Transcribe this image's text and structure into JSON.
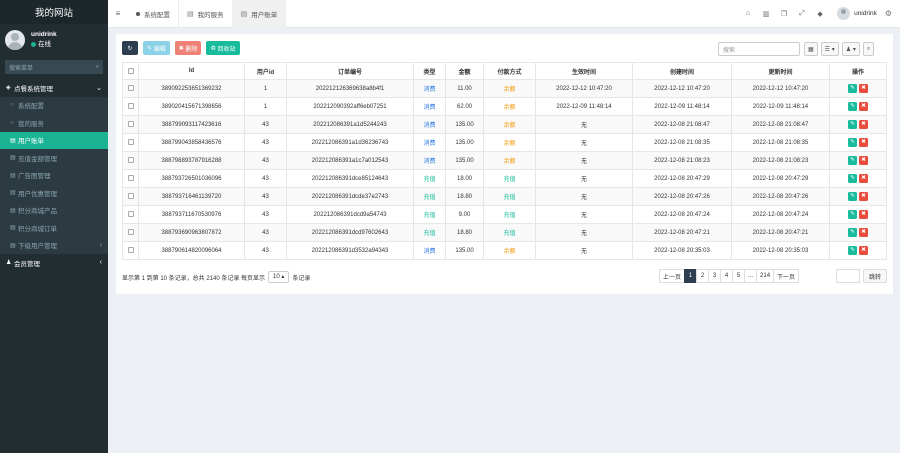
{
  "sidebar": {
    "logo": "我的网站",
    "user": {
      "name": "unidrink",
      "status": "在线"
    },
    "search_placeholder": "搜索菜单",
    "menu": [
      {
        "label": "点餐系统管理",
        "type": "parent",
        "icon": "cube-icon"
      },
      {
        "label": "系统配置",
        "type": "sub",
        "icon": "circle-icon"
      },
      {
        "label": "我的服务",
        "type": "sub",
        "icon": "circle-icon"
      },
      {
        "label": "用户账单",
        "type": "sub",
        "active": true,
        "icon": "list-icon"
      },
      {
        "label": "充值金额管理",
        "type": "sub",
        "icon": "list-icon"
      },
      {
        "label": "广告图管理",
        "type": "sub",
        "icon": "list-icon"
      },
      {
        "label": "用户优惠管理",
        "type": "sub",
        "icon": "list-icon"
      },
      {
        "label": "积分商城产品",
        "type": "sub",
        "icon": "list-icon"
      },
      {
        "label": "积分商城订单",
        "type": "sub",
        "icon": "list-icon"
      },
      {
        "label": "下级用户管理",
        "type": "sub",
        "icon": "list-icon",
        "chevron": true
      },
      {
        "label": "会员管理",
        "type": "parent",
        "icon": "user-icon",
        "chevron": true
      }
    ]
  },
  "topbar": {
    "tabs": [
      "系统配置",
      "我的服务",
      "用户账单"
    ],
    "user": "unidrink"
  },
  "toolbar": {
    "edit": "编辑",
    "delete": "删除",
    "recycle": "回收站",
    "search_placeholder": "搜索"
  },
  "table": {
    "headers": [
      "Id",
      "用户id",
      "订单编号",
      "类型",
      "金额",
      "付款方式",
      "生效时间",
      "创建时间",
      "更新时间",
      "操作"
    ],
    "rows": [
      [
        "389092253651369232",
        "1",
        "202212126369638a8b4f1",
        "消费",
        "11.00",
        "余额",
        "2022-12-12 10:47:20",
        "2022-12-12 10:47:20",
        "2022-12-12 10:47:20"
      ],
      [
        "389020415671398656",
        "1",
        "202212090392aff6eb07251",
        "消费",
        "62.00",
        "余额",
        "2022-12-09 11:48:14",
        "2022-12-09 11:48:14",
        "2022-12-09 11:48:14"
      ],
      [
        "388799093117423616",
        "43",
        "202212086391a1d5244243",
        "消费",
        "135.00",
        "余额",
        "无",
        "2022-12-08 21:08:47",
        "2022-12-08 21:08:47"
      ],
      [
        "388799043858436576",
        "43",
        "202212086391a1d36236743",
        "消费",
        "135.00",
        "余额",
        "无",
        "2022-12-08 21:08:35",
        "2022-12-08 21:08:35"
      ],
      [
        "388798893787916288",
        "43",
        "202212086391a1c7a012543",
        "消费",
        "135.00",
        "余额",
        "无",
        "2022-12-08 21:08:23",
        "2022-12-08 21:08:23"
      ],
      [
        "388793726501036096",
        "43",
        "202212086391dce85124643",
        "充值",
        "18.00",
        "充值",
        "无",
        "2022-12-08 20:47:29",
        "2022-12-08 20:47:29"
      ],
      [
        "388793716461139720",
        "43",
        "202212086391dcde37e2743",
        "充值",
        "18.80",
        "充值",
        "无",
        "2022-12-08 20:47:26",
        "2022-12-08 20:47:26"
      ],
      [
        "388793711670530976",
        "43",
        "202212086391dcd9a54743",
        "充值",
        "9.00",
        "充值",
        "无",
        "2022-12-08 20:47:24",
        "2022-12-08 20:47:24"
      ],
      [
        "388793690963807872",
        "43",
        "202212086391dcd97602643",
        "充值",
        "18.80",
        "充值",
        "无",
        "2022-12-08 20:47:21",
        "2022-12-08 20:47:21"
      ],
      [
        "388790614820096064",
        "43",
        "202212086391d3532a94343",
        "消费",
        "135.00",
        "余额",
        "无",
        "2022-12-08 20:35:03",
        "2022-12-08 20:35:03"
      ]
    ]
  },
  "pagination": {
    "info_prefix": "显示第 1 到第 10 条记录，总共 2140 条记录 每页显示",
    "page_size": "10",
    "info_suffix": "条记录",
    "prev": "上一页",
    "pages": [
      "1",
      "2",
      "3",
      "4",
      "5",
      "...",
      "214"
    ],
    "next": "下一页",
    "jump": "跳转"
  },
  "colors": {
    "sidebar": "#222d32",
    "accent": "#1ab394",
    "balance": "#f39c12",
    "recharge": "#18bc9c",
    "consume": "#2c7be5",
    "danger": "#e74c3c"
  }
}
